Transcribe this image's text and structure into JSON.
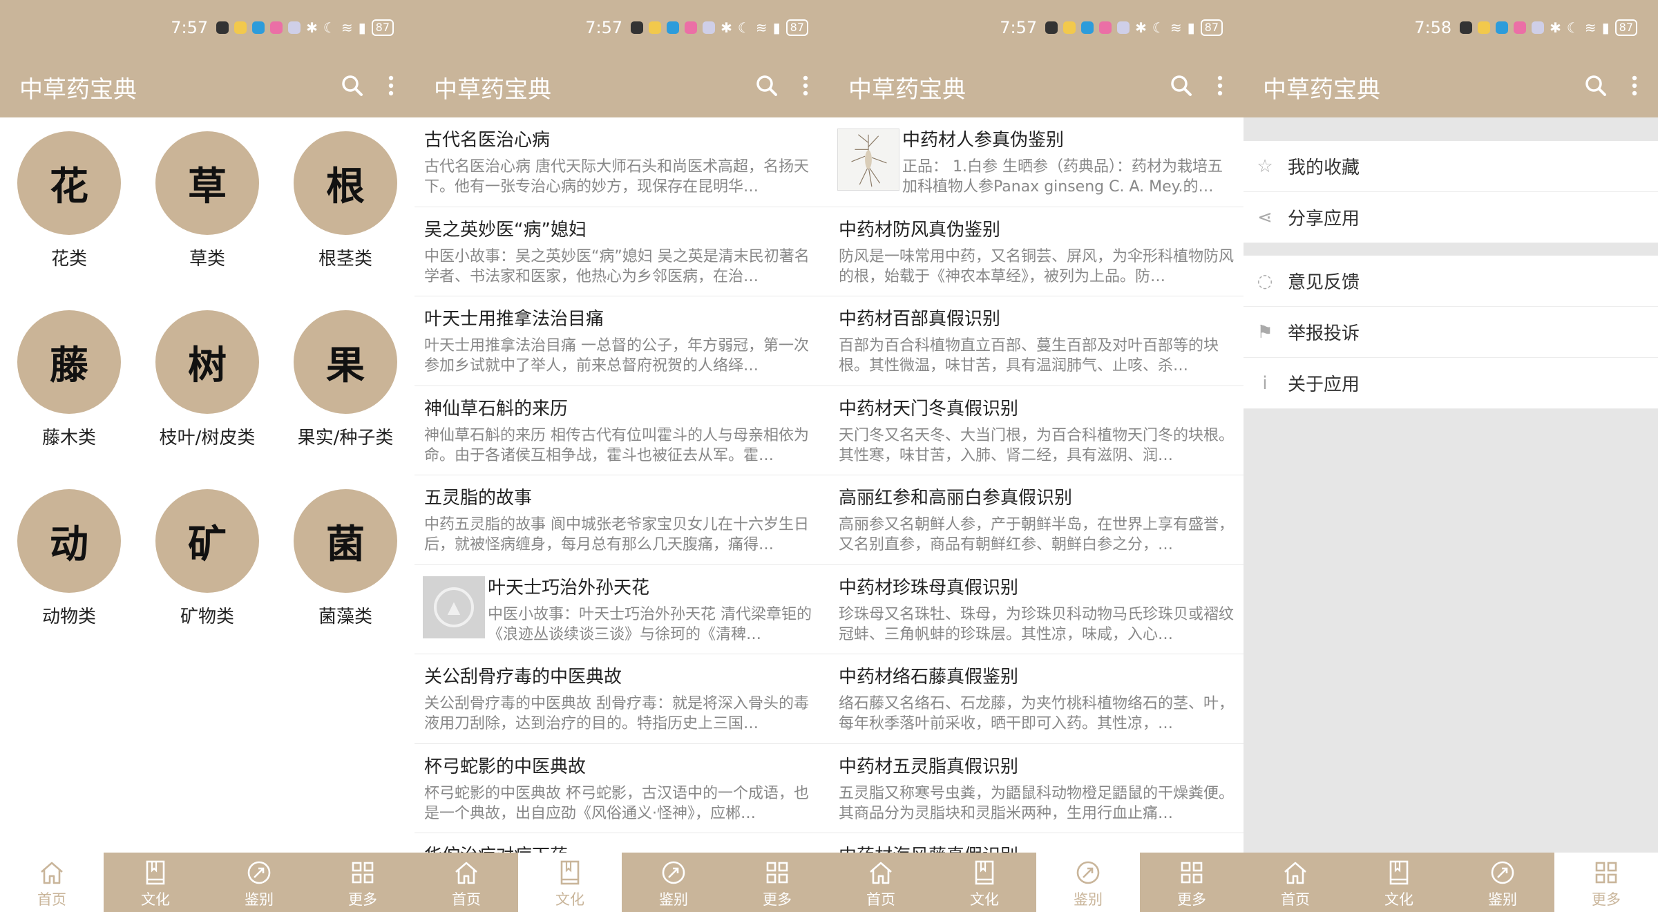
{
  "app_title": "中草药宝典",
  "status_times": [
    "7:57",
    "7:57",
    "7:57",
    "7:58"
  ],
  "battery": "87",
  "colors": {
    "accent": "#c9b59a",
    "tab_active_bg": "#ffffff"
  },
  "nav": [
    "首页",
    "文化",
    "鉴别",
    "更多"
  ],
  "categories": [
    {
      "char": "花",
      "label": "花类"
    },
    {
      "char": "草",
      "label": "草类"
    },
    {
      "char": "根",
      "label": "根茎类"
    },
    {
      "char": "藤",
      "label": "藤木类"
    },
    {
      "char": "树",
      "label": "枝叶/树皮类"
    },
    {
      "char": "果",
      "label": "果实/种子类"
    },
    {
      "char": "动",
      "label": "动物类"
    },
    {
      "char": "矿",
      "label": "矿物类"
    },
    {
      "char": "菌",
      "label": "菌藻类"
    }
  ],
  "culture": [
    {
      "title": "古代名医治心病",
      "desc": "古代名医治心病 唐代天际大师石头和尚医术高超，名扬天下。他有一张专治心病的妙方，现保存在昆明华…"
    },
    {
      "title": "吴之英妙医“病”媳妇",
      "desc": "中医小故事：吴之英妙医“病”媳妇 吴之英是清末民初著名学者、书法家和医家，他热心为乡邻医病，在治…"
    },
    {
      "title": "叶天士用推拿法治目痛",
      "desc": "叶天士用推拿法治目痛 一总督的公子，年方弱冠，第一次参加乡试就中了举人，前来总督府祝贺的人络绎…"
    },
    {
      "title": "神仙草石斛的来历",
      "desc": "神仙草石斛的来历 相传古代有位叫霍斗的人与母亲相依为命。由于各诸侯互相争战，霍斗也被征去从军。霍…"
    },
    {
      "title": "五灵脂的故事",
      "desc": "中药五灵脂的故事 阆中城张老爷家宝贝女儿在十六岁生日后，就被怪病缠身，每月总有那么几天腹痛，痛得…"
    },
    {
      "title": "叶天士巧治外孙天花",
      "desc": "中医小故事：叶天士巧治外孙天花 清代梁章钜的《浪迹丛谈续谈三谈》与徐珂的《清稗…",
      "image": "placeholder"
    },
    {
      "title": "关公刮骨疗毒的中医典故",
      "desc": "关公刮骨疗毒的中医典故 刮骨疗毒：就是将深入骨头的毒液用刀刮除，达到治疗的目的。特指历史上三国…"
    },
    {
      "title": "杯弓蛇影的中医典故",
      "desc": "杯弓蛇影的中医典故 杯弓蛇影，古汉语中的一个成语，也是一个典故，出自应劭《风俗通义·怪神》，应郴…"
    },
    {
      "title": "华佗治疗对症下药",
      "desc": ""
    }
  ],
  "identify": [
    {
      "title": "中药材人参真伪鉴别",
      "desc": "正品： 1.白参 生晒参（药典品）：药材为栽培五加科植物人参Panax ginseng C. A. Mey.的…",
      "image": "ginseng"
    },
    {
      "title": "中药材防风真伪鉴别",
      "desc": "防风是一味常用中药，又名铜芸、屏风，为伞形科植物防风的根，始载于《神农本草经》，被列为上品。防…"
    },
    {
      "title": "中药材百部真假识别",
      "desc": "百部为百合科植物直立百部、蔓生百部及对叶百部等的块根。其性微温，味甘苦，具有温润肺气、止咳、杀…"
    },
    {
      "title": "中药材天门冬真假识别",
      "desc": "天门冬又名天冬、大当门根，为百合科植物天门冬的块根。其性寒，味甘苦，入肺、肾二经，具有滋阴、润…"
    },
    {
      "title": "高丽红参和高丽白参真假识别",
      "desc": "高丽参又名朝鲜人参，产于朝鲜半岛，在世界上享有盛誉，又名别直参，商品有朝鲜红参、朝鲜白参之分，…"
    },
    {
      "title": "中药材珍珠母真假识别",
      "desc": "珍珠母又名珠牡、珠母，为珍珠贝科动物马氏珍珠贝或褶纹冠蚌、三角帆蚌的珍珠层。其性凉，味咸，入心…"
    },
    {
      "title": "中药材络石藤真假鉴别",
      "desc": "络石藤又名络石、石龙藤，为夹竹桃科植物络石的茎、叶，每年秋季落叶前采收，晒干即可入药。其性凉，…"
    },
    {
      "title": "中药材五灵脂真假识别",
      "desc": "五灵脂又称寒号虫粪，为鼯鼠科动物橙足鼯鼠的干燥粪便。其商品分为灵脂块和灵脂米两种，生用行血止痛…"
    },
    {
      "title": "中药材海风藤真假识别",
      "desc": ""
    }
  ],
  "menu_group1": [
    {
      "icon": "star-icon",
      "glyph": "☆",
      "label": "我的收藏"
    },
    {
      "icon": "share-icon",
      "glyph": "⋖",
      "label": "分享应用"
    }
  ],
  "menu_group2": [
    {
      "icon": "feedback-icon",
      "glyph": "◌",
      "label": "意见反馈"
    },
    {
      "icon": "flag-icon",
      "glyph": "⚑",
      "label": "举报投诉"
    },
    {
      "icon": "info-icon",
      "glyph": "i",
      "label": "关于应用"
    }
  ]
}
